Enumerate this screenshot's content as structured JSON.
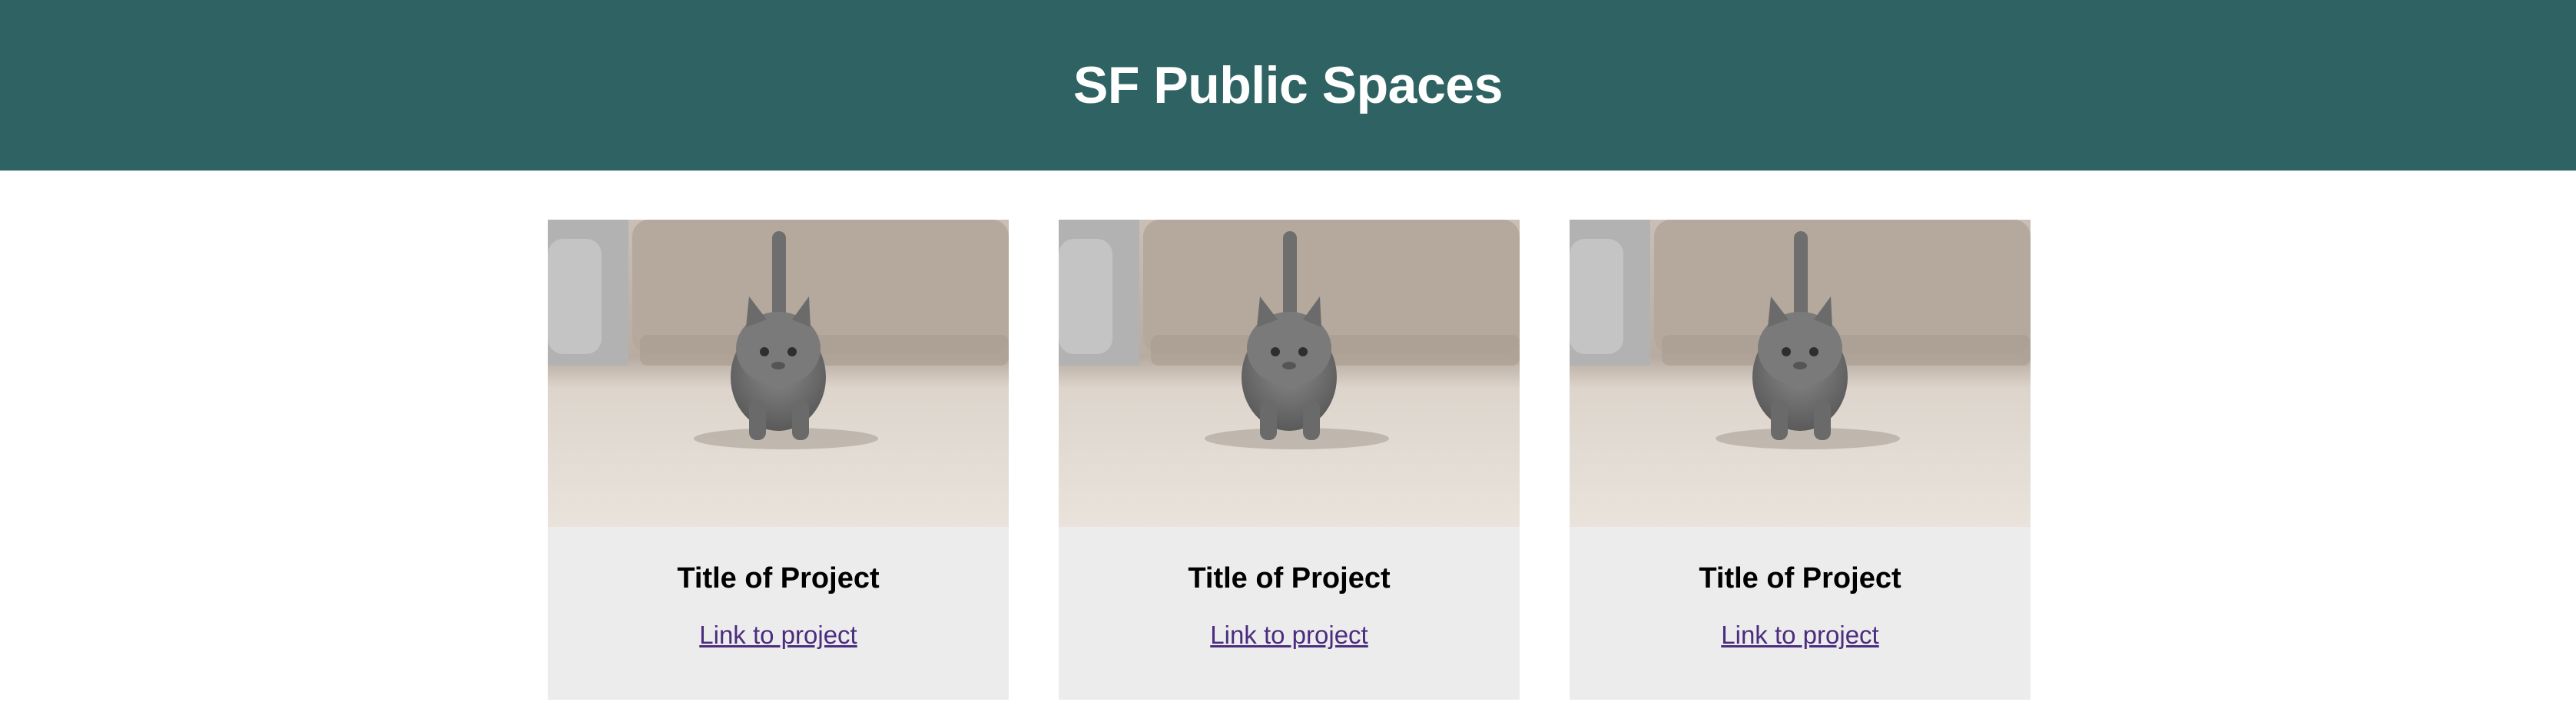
{
  "header": {
    "title": "SF Public Spaces",
    "background": "#2f6363"
  },
  "cards": [
    {
      "image_icon": "kitten-photo",
      "title": "Title of Project",
      "link_label": "Link to project"
    },
    {
      "image_icon": "kitten-photo",
      "title": "Title of Project",
      "link_label": "Link to project"
    },
    {
      "image_icon": "kitten-photo",
      "title": "Title of Project",
      "link_label": "Link to project"
    }
  ],
  "colors": {
    "card_bg": "#ececec",
    "link": "#4b2c7f"
  }
}
